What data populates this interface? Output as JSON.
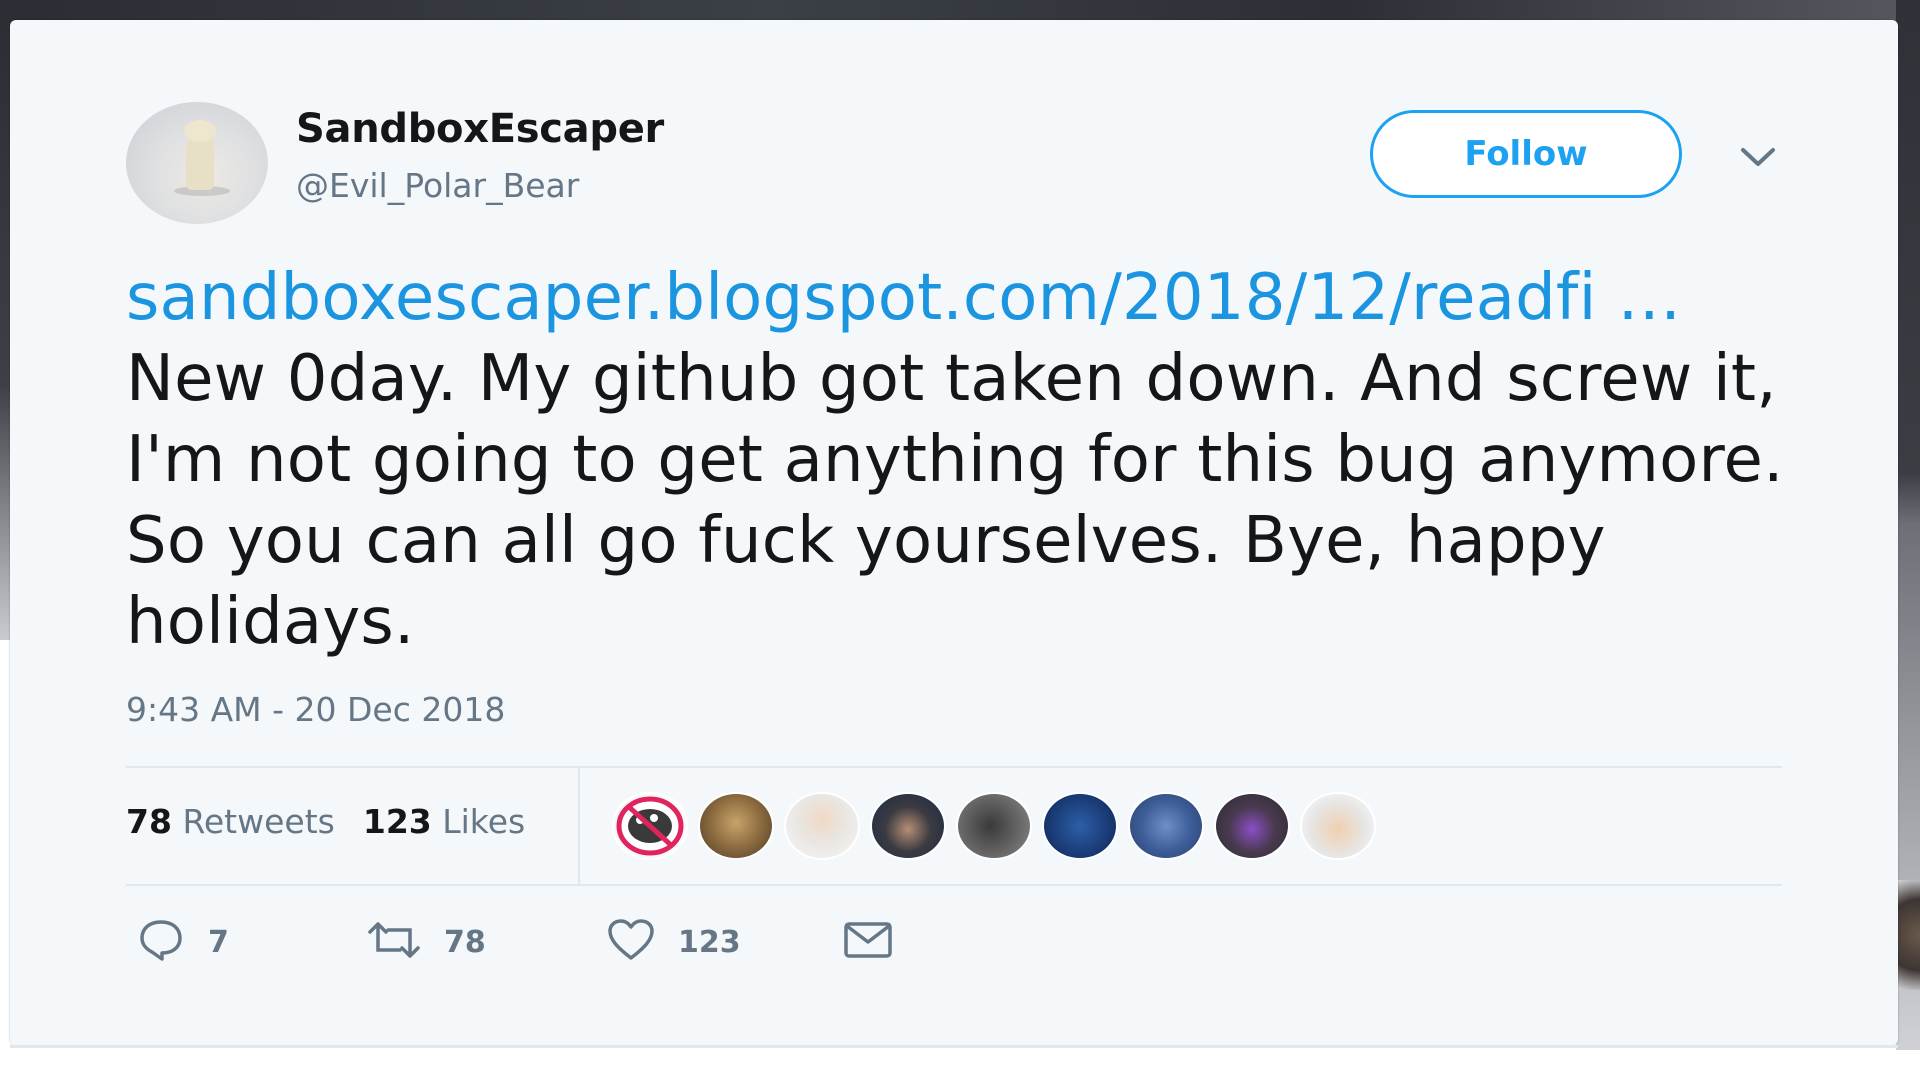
{
  "tweet": {
    "display_name": "SandboxEscaper",
    "handle": "@Evil_Polar_Bear",
    "follow_label": "Follow",
    "link_text": "sandboxescaper.blogspot.com/2018/12/readfi …",
    "body_text": " New 0day. My github got taken down. And screw it, I'm not going to get anything for this bug anymore. So you can all go fuck yourselves. Bye, happy holidays.",
    "timestamp": "9:43 AM - 20 Dec 2018"
  },
  "stats": {
    "retweets_count": "78",
    "retweets_label": "Retweets",
    "likes_count": "123",
    "likes_label": "Likes"
  },
  "actions": {
    "reply_count": "7",
    "retweet_count": "78",
    "like_count": "123"
  },
  "likers": [
    {
      "icon": "no-bug-avatar"
    },
    {
      "icon": "group-photo-avatar"
    },
    {
      "icon": "bald-man-avatar"
    },
    {
      "icon": "man-dark-hair-avatar"
    },
    {
      "icon": "man-grey-avatar"
    },
    {
      "icon": "man-blue-avatar"
    },
    {
      "icon": "group-blue-avatar"
    },
    {
      "icon": "man-purple-glasses-avatar"
    },
    {
      "icon": "cartoon-man-avatar"
    }
  ],
  "colors": {
    "accent": "#1da1f2",
    "link": "#1b95e0",
    "text": "#14171a",
    "muted": "#657786",
    "card_bg": "#f5f8fa"
  }
}
